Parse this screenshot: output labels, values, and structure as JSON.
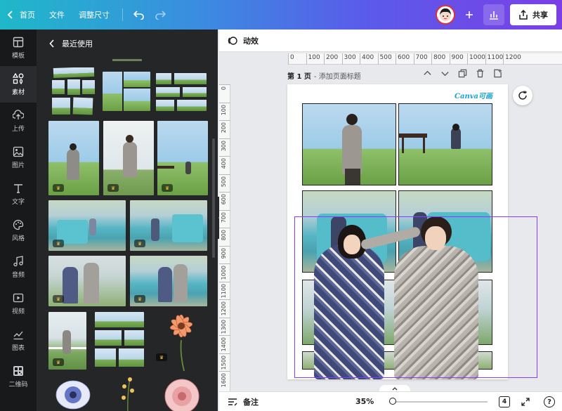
{
  "topbar": {
    "home_label": "首页",
    "file_label": "文件",
    "resize_label": "调整尺寸",
    "share_label": "共享"
  },
  "rail": {
    "items": [
      {
        "label": "模板",
        "icon": "layout-icon"
      },
      {
        "label": "素材",
        "icon": "elements-icon"
      },
      {
        "label": "上传",
        "icon": "upload-icon"
      },
      {
        "label": "图片",
        "icon": "photo-icon"
      },
      {
        "label": "文字",
        "icon": "text-icon"
      },
      {
        "label": "风格",
        "icon": "palette-icon"
      },
      {
        "label": "音频",
        "icon": "music-icon"
      },
      {
        "label": "视频",
        "icon": "video-icon"
      },
      {
        "label": "图表",
        "icon": "chart-icon"
      },
      {
        "label": "二维码",
        "icon": "qrcode-icon"
      }
    ],
    "active_index": 1
  },
  "panel": {
    "title": "最近使用"
  },
  "editor": {
    "animate_label": "动效",
    "page_title": "第 1 页",
    "page_subtitle": "- 添加页面标题",
    "logo_text": "Canva可画",
    "ruler_h": [
      "0",
      "100",
      "200",
      "300",
      "400",
      "500",
      "600",
      "700",
      "800",
      "900",
      "1000",
      "1100",
      "1200"
    ],
    "ruler_v": [
      "0",
      "100",
      "200",
      "300",
      "400",
      "500",
      "600",
      "700",
      "800",
      "900",
      "1000",
      "1100",
      "1200",
      "1300",
      "1400",
      "1500",
      "1600"
    ]
  },
  "bottombar": {
    "notes_label": "备注",
    "zoom": "35%",
    "page_count": "4",
    "help": "?"
  },
  "colors": {
    "accent": "#8b3dff",
    "gradient_start": "#1fb8c9",
    "gradient_end": "#7b3fe6"
  }
}
